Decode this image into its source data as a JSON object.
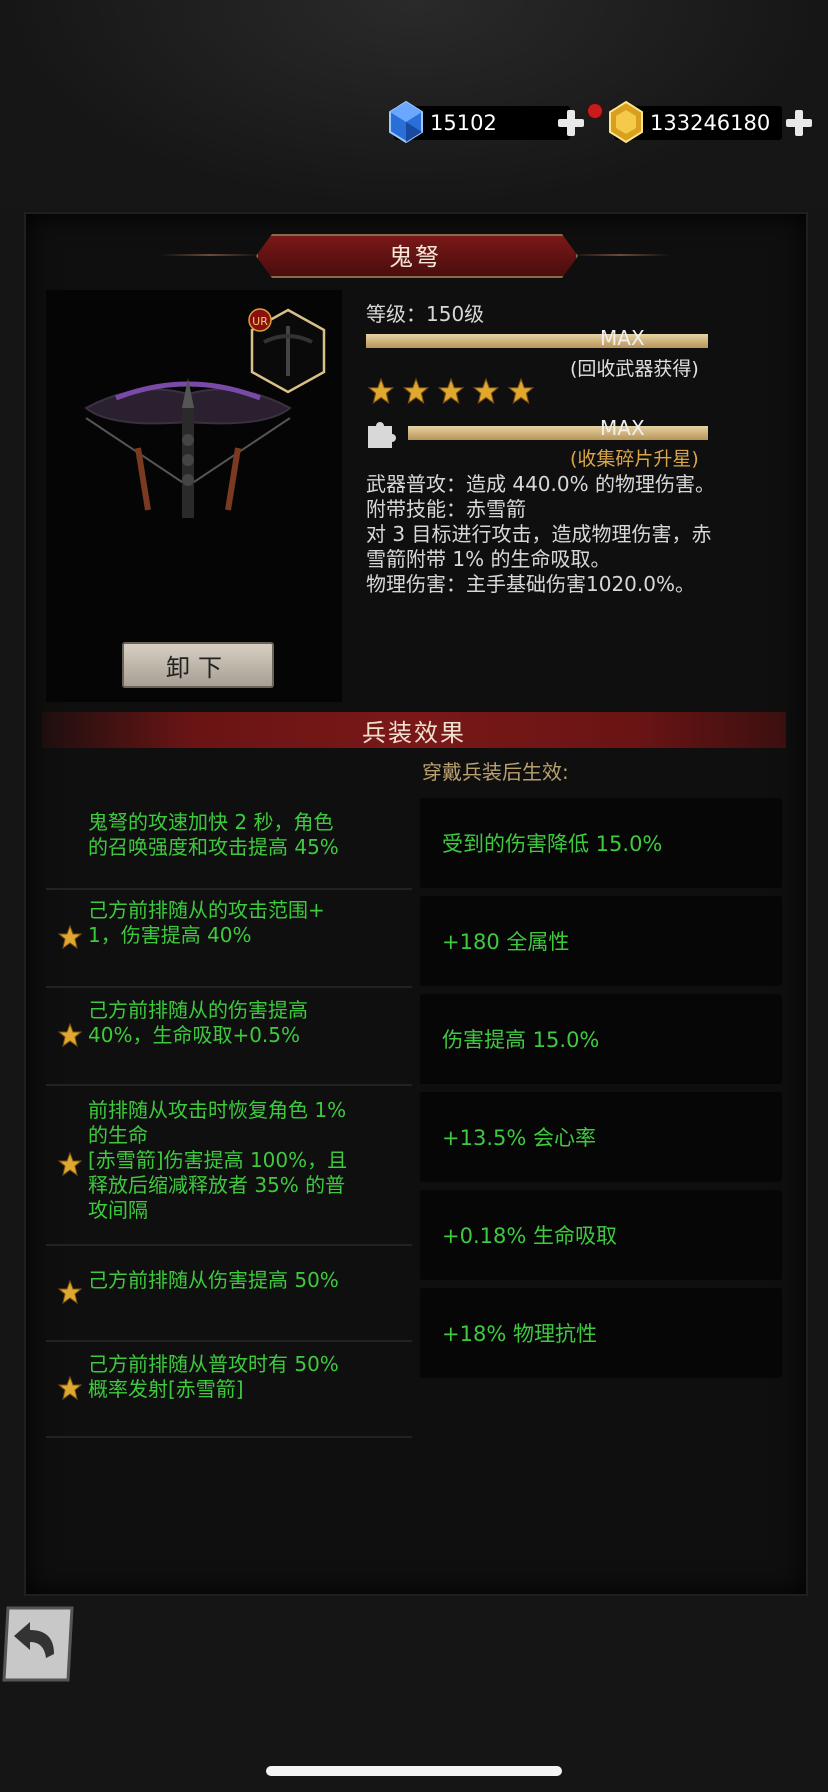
{
  "currency": {
    "gems": "15102",
    "gold": "133246180"
  },
  "weapon": {
    "name": "鬼弩",
    "rarity_badge": "UR",
    "level_text": "等级：150级",
    "level_bar_label": "MAX",
    "level_note": "(回收武器获得)",
    "stars": 5,
    "shard_bar_label": "MAX",
    "shard_note": "(收集碎片升星)",
    "unequip_label": "卸下",
    "description": [
      "武器普攻：造成 440.0% 的物理伤害。",
      "附带技能：赤雪箭",
      "对 3 目标进行攻击，造成物理伤害，赤",
      "雪箭附带 1% 的生命吸取。",
      "物理伤害：主手基础伤害1020.0%。"
    ]
  },
  "effects": {
    "section_title": "兵装效果",
    "subtitle": "穿戴兵装后生效:",
    "rows": [
      {
        "starred": false,
        "lines": [
          "鬼弩的攻速加快 2 秒，角色",
          "的召唤强度和攻击提高 45%"
        ]
      },
      {
        "starred": true,
        "lines": [
          "己方前排随从的攻击范围+",
          "1，伤害提高 40%"
        ]
      },
      {
        "starred": true,
        "lines": [
          "己方前排随从的伤害提高",
          "40%，生命吸取+0.5%"
        ]
      },
      {
        "starred": true,
        "lines": [
          "前排随从攻击时恢复角色 1%",
          "的生命",
          "[赤雪箭]伤害提高 100%，且",
          "释放后缩减释放者 35% 的普",
          "攻间隔"
        ]
      },
      {
        "starred": true,
        "lines": [
          "己方前排随从伤害提高 50%"
        ]
      },
      {
        "starred": true,
        "lines": [
          "己方前排随从普攻时有 50%",
          "概率发射[赤雪箭]"
        ]
      }
    ],
    "bonuses": [
      "受到的伤害降低 15.0%",
      "+180 全属性",
      "伤害提高 15.0%",
      "+13.5% 会心率",
      "+0.18% 生命吸取",
      "+18% 物理抗性"
    ]
  },
  "colors": {
    "effect_green": "#3ec93e",
    "note_gold": "#d9a548",
    "banner_red": "#7a1818"
  },
  "icons": [
    "gem-icon",
    "gold-icon",
    "plus-icon",
    "star-icon",
    "puzzle-icon",
    "back-arrow-icon"
  ]
}
